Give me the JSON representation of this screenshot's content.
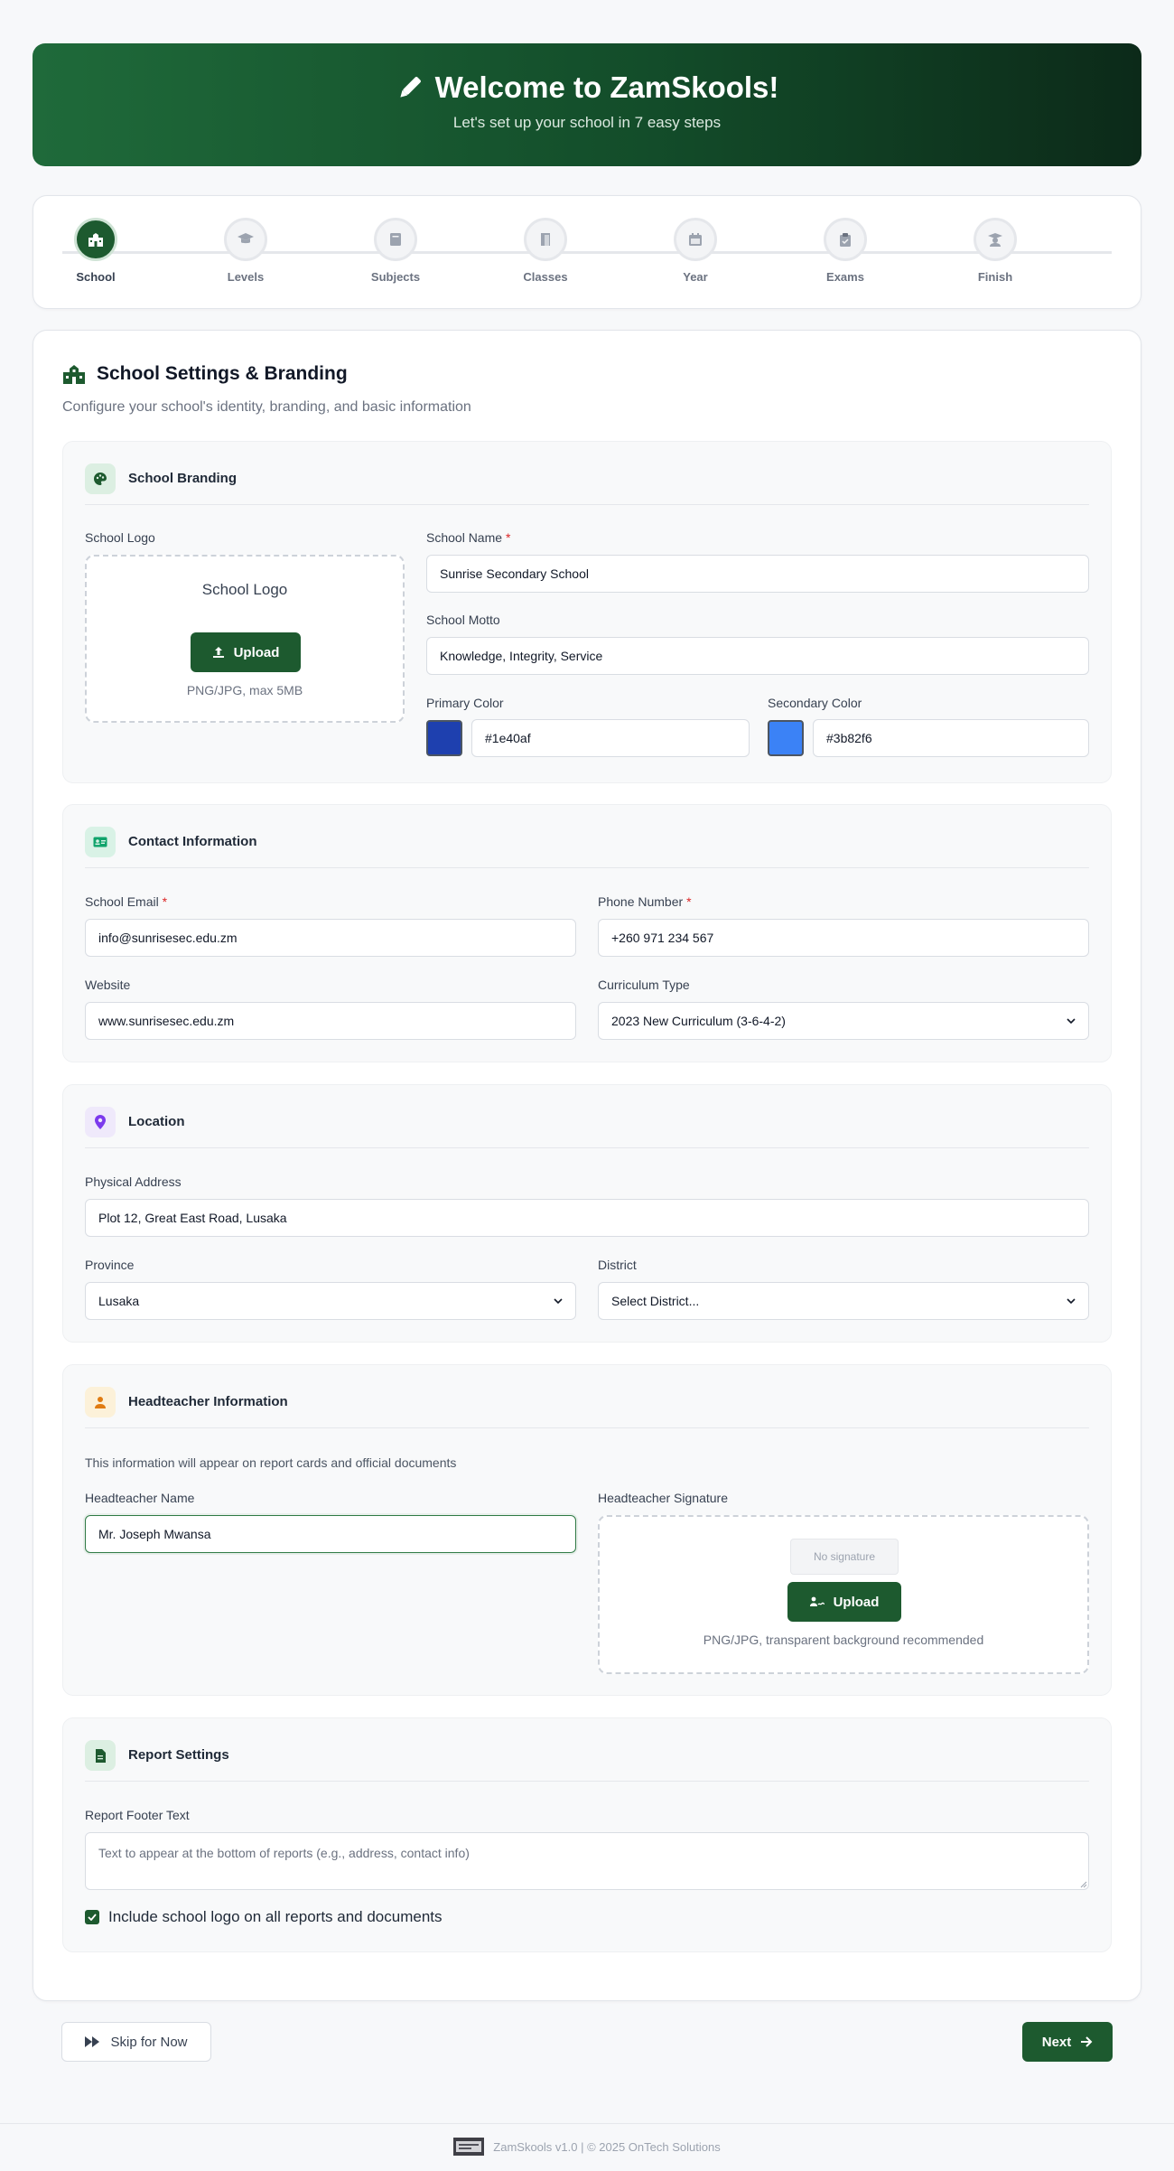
{
  "header": {
    "title": "Welcome to ZamSkools!",
    "subtitle": "Let's set up your school in 7 easy steps"
  },
  "steps": [
    {
      "label": "School",
      "icon": "school-icon",
      "active": true
    },
    {
      "label": "Levels",
      "icon": "graduation-cap-icon"
    },
    {
      "label": "Subjects",
      "icon": "book-icon"
    },
    {
      "label": "Classes",
      "icon": "door-icon"
    },
    {
      "label": "Year",
      "icon": "calendar-icon"
    },
    {
      "label": "Exams",
      "icon": "clipboard-icon"
    },
    {
      "label": "Finish",
      "icon": "graduate-icon"
    }
  ],
  "page": {
    "title": "School Settings & Branding",
    "subtitle": "Configure your school's identity, branding, and basic information"
  },
  "branding": {
    "title": "School Branding",
    "logo_label": "School Logo",
    "logo_alt": "School Logo",
    "upload_label": "Upload",
    "logo_hint": "PNG/JPG, max 5MB",
    "name_label": "School Name",
    "name_value": "Sunrise Secondary School",
    "motto_label": "School Motto",
    "motto_value": "Knowledge, Integrity, Service",
    "primary_label": "Primary Color",
    "primary_value": "#1e40af",
    "secondary_label": "Secondary Color",
    "secondary_value": "#3b82f6"
  },
  "contact": {
    "title": "Contact Information",
    "email_label": "School Email",
    "email_value": "info@sunrisesec.edu.zm",
    "phone_label": "Phone Number",
    "phone_value": "+260 971 234 567",
    "website_label": "Website",
    "website_value": "www.sunrisesec.edu.zm",
    "curriculum_label": "Curriculum Type",
    "curriculum_value": "2023 New Curriculum (3-6-4-2)"
  },
  "location": {
    "title": "Location",
    "address_label": "Physical Address",
    "address_value": "Plot 12, Great East Road, Lusaka",
    "province_label": "Province",
    "province_value": "Lusaka",
    "district_label": "District",
    "district_value": "Select District..."
  },
  "headteacher": {
    "title": "Headteacher Information",
    "note": "This information will appear on report cards and official documents",
    "name_label": "Headteacher Name",
    "name_value": "Mr. Joseph Mwansa",
    "signature_label": "Headteacher Signature",
    "no_signature": "No signature",
    "upload_label": "Upload",
    "hint": "PNG/JPG, transparent background recommended"
  },
  "report": {
    "title": "Report Settings",
    "footer_label": "Report Footer Text",
    "footer_placeholder": "Text to appear at the bottom of reports (e.g., address, contact info)",
    "checkbox_label": "Include school logo on all reports and documents",
    "checkbox_checked": true
  },
  "actions": {
    "skip_label": "Skip for Now",
    "next_label": "Next"
  },
  "footer": {
    "text": "ZamSkools v1.0 | © 2025 OnTech Solutions"
  },
  "colors": {
    "brand_green": "#1d5a2f",
    "required": "#dc2626"
  }
}
